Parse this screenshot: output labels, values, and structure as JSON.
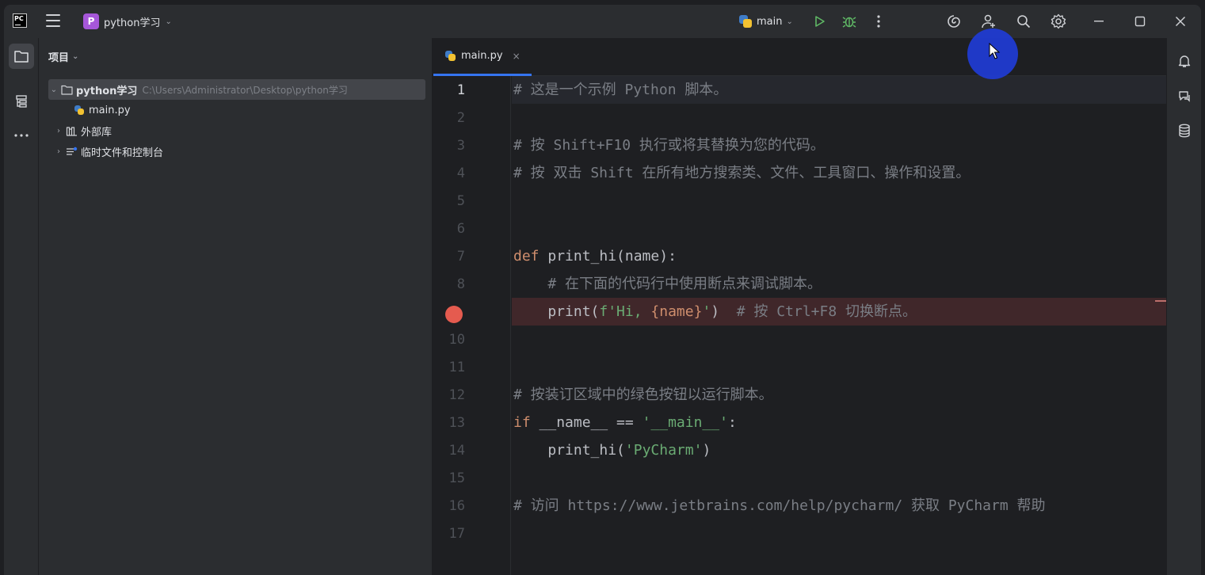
{
  "titlebar": {
    "app_icon": "pycharm-logo",
    "menu_icon": "hamburger-menu-icon",
    "project": {
      "badge": "P",
      "name": "python学习",
      "chevron": "⌄"
    },
    "run_config": {
      "name": "main",
      "chevron": "⌄"
    },
    "icons": [
      "run-icon",
      "debug-icon",
      "more-icon",
      "ai-assistant-icon",
      "add-user-icon",
      "search-icon",
      "settings-icon",
      "minimize-icon",
      "maximize-icon",
      "close-icon"
    ]
  },
  "project_pane": {
    "title": "项目",
    "chevron": "⌄",
    "tree": [
      {
        "label": "python学习",
        "path": "C:\\Users\\Administrator\\Desktop\\python学习",
        "arrow": "⌄",
        "icon": "folder-icon"
      },
      {
        "label": "main.py",
        "icon": "python-file-icon"
      },
      {
        "label": "外部库",
        "arrow": "›",
        "icon": "library-icon"
      },
      {
        "label": "临时文件和控制台",
        "arrow": "›",
        "icon": "scratch-icon"
      }
    ]
  },
  "editor": {
    "tab": {
      "label": "main.py",
      "close": "×"
    },
    "line_numbers": [
      "1",
      "2",
      "3",
      "4",
      "5",
      "6",
      "7",
      "8",
      "9",
      "10",
      "11",
      "12",
      "13",
      "14",
      "15",
      "16",
      "17"
    ],
    "breakpoint_line": 9,
    "lines": {
      "l1": "# 这是一个示例 Python 脚本。",
      "l3": "# 按 Shift+F10 执行或将其替换为您的代码。",
      "l4": "# 按 双击 Shift 在所有地方搜索类、文件、工具窗口、操作和设置。",
      "l7_kw": "def",
      "l7_rest": " print_hi(name):",
      "l8": "    # 在下面的代码行中使用断点来调试脚本。",
      "l9_a": "    print(",
      "l9_str1": "f'Hi, ",
      "l9_brace": "{name}",
      "l9_str2": "'",
      "l9_b": ")  ",
      "l9_cmt": "# 按 Ctrl+F8 切换断点。",
      "l12": "# 按装订区域中的绿色按钮以运行脚本。",
      "l13_kw": "if",
      "l13_a": " __name__ == ",
      "l13_str": "'__main__'",
      "l13_b": ":",
      "l14_a": "    print_hi(",
      "l14_str": "'PyCharm'",
      "l14_b": ")",
      "l16": "# 访问 https://www.jetbrains.com/help/pycharm/ 获取 PyCharm 帮助"
    }
  },
  "colors": {
    "accent": "#3574f0",
    "breakpoint": "#e55b4f",
    "keyword": "#cf8e6d",
    "string": "#6aab73",
    "comment": "#7a7e85"
  }
}
